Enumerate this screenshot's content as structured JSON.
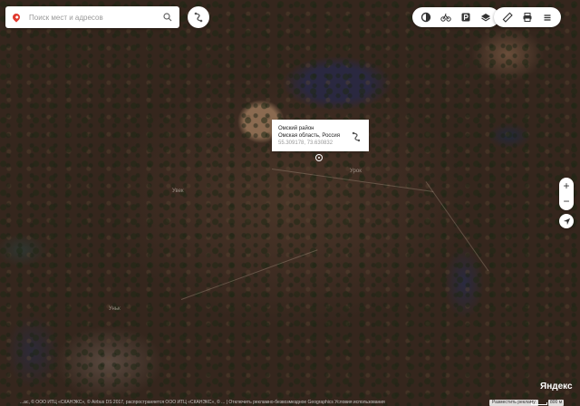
{
  "search": {
    "placeholder": "Поиск мест и адресов"
  },
  "map": {
    "labels": [
      "Увек",
      "Урок",
      "Уньк"
    ]
  },
  "popup": {
    "district": "Омский район",
    "region": "Омская область, Россия",
    "coords": "55.309178, 73.630832"
  },
  "controls": {
    "zoom_in": "+",
    "zoom_out": "−"
  },
  "footer": {
    "attribution": "...ас, © ООО ИТЦ «СКАНЭКС», © Airbus DS 2017, распространяется ООО ИТЦ «СКАНЭКС», © ... | Отключить рекламно-безвозмездное Geographics Условия использования",
    "ad_button": "Разместить рекламу",
    "logo": "Яндекс",
    "scale": "800 м"
  },
  "colors": {
    "pin": "#e03a2f",
    "popup_coords": "#999999"
  }
}
